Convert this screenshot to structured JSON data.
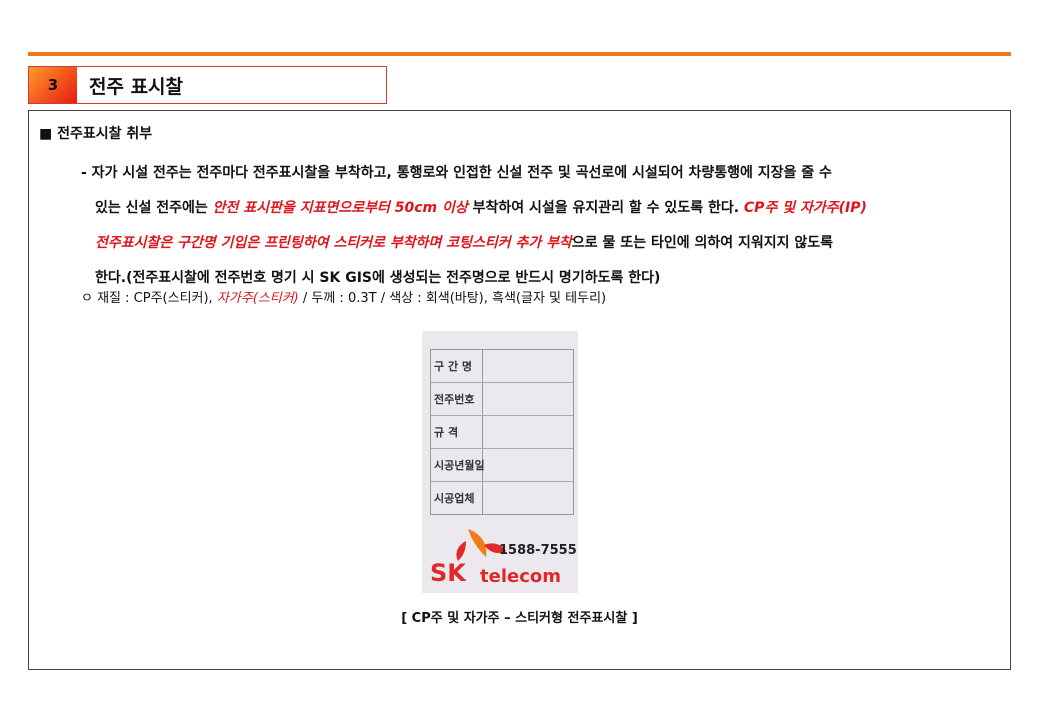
{
  "section": {
    "number": "3",
    "title": "전주 표시찰"
  },
  "heading": "■ 전주표시찰 취부",
  "paragraph": {
    "l1": "- 자가 시설 전주는 전주마다 전주표시찰을 부착하고, 통행로와 인접한 신설 전주 및 곡선로에 시설되어 차량통행에 지장을 줄 수",
    "l2a": "있는 신설 전주에는 ",
    "l2b": "안전 표시판을 지표면으로부터 50cm 이상",
    "l2c": " 부착하여 시설을 유지관리 할 수 있도록 한다. ",
    "l2d": "CP주 및 자가주(IP)",
    "l3a": "전주표시찰은 구간명 기입은 프린팅하여 스티커로 부착하며 코팅스티커 추가 부착",
    "l3b": "으로 물 또는 타인에 의하여 지워지지 않도록",
    "l4": "한다.(전주표시찰에 전주번호 명기 시 SK GIS에 생성되는 전주명으로 반드시 명기하도록 한다)"
  },
  "spec": {
    "a": "ㅇ 재질 : CP주(스티커), ",
    "b": "자가주(스티커)",
    "c": " / 두께 : 0.3T / 색상 : 회색(바탕), 흑색(글자 및 테두리)"
  },
  "sticker": {
    "rows": [
      "구 간 명",
      "전주번호",
      "규    격",
      "시공년월일",
      "시공업체"
    ],
    "phone": "1588-7555",
    "brand_sk": "SK",
    "brand_telecom": "telecom"
  },
  "caption": "[ CP주 및 자가주 – 스티커형 전주표시찰 ]",
  "colors": {
    "accent_orange": "#ee7a1c",
    "emphasis_red": "#e0141c"
  }
}
